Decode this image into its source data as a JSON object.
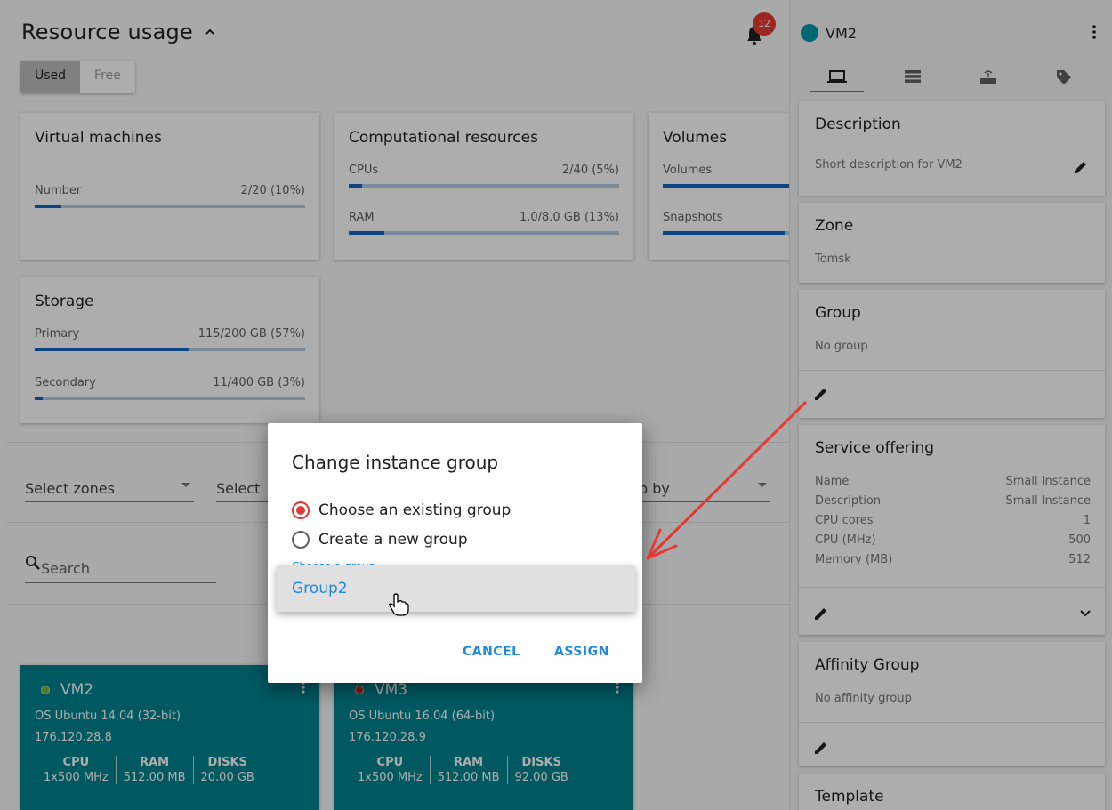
{
  "header": {
    "title": "Resource usage",
    "toggle": [
      "Used",
      "Free"
    ],
    "notifications_count": "12"
  },
  "cards": {
    "vm": {
      "title": "Virtual machines",
      "metrics": [
        {
          "label": "Number",
          "value": "2/20 (10%)",
          "fraction": 0.1
        }
      ]
    },
    "compute": {
      "title": "Computational resources",
      "metrics": [
        {
          "label": "CPUs",
          "value": "2/40 (5%)",
          "fraction": 0.05
        },
        {
          "label": "RAM",
          "value": "1.0/8.0 GB (13%)",
          "fraction": 0.13
        }
      ]
    },
    "volumes": {
      "title": "Volumes",
      "metrics": [
        {
          "label": "Volumes",
          "value": "",
          "fraction": 0.5
        },
        {
          "label": "Snapshots",
          "value": "",
          "fraction": 0.45
        }
      ]
    },
    "storage": {
      "title": "Storage",
      "metrics": [
        {
          "label": "Primary",
          "value": "115/200 GB (57%)",
          "fraction": 0.57
        },
        {
          "label": "Secondary",
          "value": "11/400 GB (3%)",
          "fraction": 0.03
        }
      ]
    }
  },
  "filters": {
    "zones": "Select zones",
    "second": "Select",
    "group_by": "p by",
    "search_label": "Search"
  },
  "vms": [
    {
      "name": "VM2",
      "os": "OS Ubuntu 14.04 (32-bit)",
      "ip": "176.120.28.8",
      "status_color": "#7cb342",
      "stats": [
        {
          "h": "CPU",
          "v": "1x500 MHz"
        },
        {
          "h": "RAM",
          "v": "512.00 MB"
        },
        {
          "h": "DISKS",
          "v": "20.00 GB"
        }
      ]
    },
    {
      "name": "VM3",
      "os": "OS Ubuntu 16.04 (64-bit)",
      "ip": "176.120.28.9",
      "status_color": "#c62828",
      "stats": [
        {
          "h": "CPU",
          "v": "1x500 MHz"
        },
        {
          "h": "RAM",
          "v": "512.00 MB"
        },
        {
          "h": "DISKS",
          "v": "92.00 GB"
        }
      ]
    }
  ],
  "dialog": {
    "title": "Change instance group",
    "option_existing": "Choose an existing group",
    "option_new": "Create a new group",
    "hint": "Choose a group",
    "dropdown_option": "Group2",
    "cancel": "CANCEL",
    "assign": "ASSIGN"
  },
  "sidebar": {
    "vm_name": "VM2",
    "tabs": [
      "laptop-icon",
      "storage-icon",
      "router-icon",
      "tag-icon"
    ],
    "description": {
      "title": "Description",
      "text": "Short description for VM2"
    },
    "zone": {
      "title": "Zone",
      "text": "Tomsk"
    },
    "group": {
      "title": "Group",
      "text": "No group"
    },
    "service_offering": {
      "title": "Service offering",
      "rows": [
        {
          "k": "Name",
          "v": "Small Instance"
        },
        {
          "k": "Description",
          "v": "Small Instance"
        },
        {
          "k": "CPU cores",
          "v": "1"
        },
        {
          "k": "CPU (MHz)",
          "v": "500"
        },
        {
          "k": "Memory (MB)",
          "v": "512"
        }
      ]
    },
    "affinity": {
      "title": "Affinity Group",
      "text": "No affinity group"
    },
    "template": {
      "title": "Template"
    }
  },
  "colors": {
    "accent": "#1e88e5",
    "vm_card": "#00838f",
    "radio": "#e53935",
    "annotation_arrow": "#e53935"
  }
}
